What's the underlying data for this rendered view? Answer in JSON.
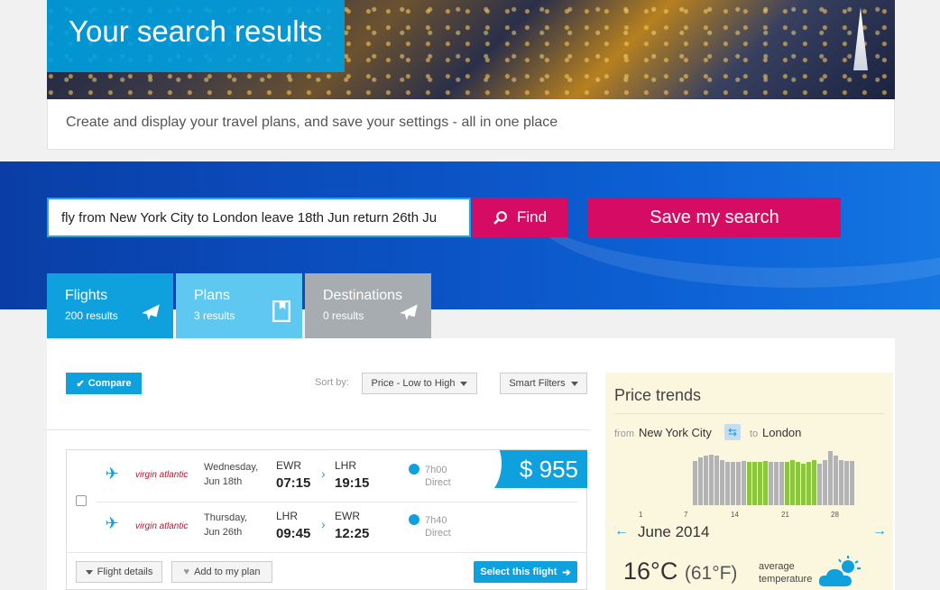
{
  "header": {
    "title": "Your search results",
    "intro": "Create and display your travel plans, and save your settings - all in one place"
  },
  "search": {
    "query": "fly from New York City to London leave 18th Jun return 26th Ju",
    "find_label": "Find",
    "save_label": "Save my search"
  },
  "tabs": [
    {
      "label": "Flights",
      "count": "200 results",
      "icon": "plane-icon"
    },
    {
      "label": "Plans",
      "count": "3 results",
      "icon": "bookmark-icon"
    },
    {
      "label": "Destinations",
      "count": "0 results",
      "icon": "plane-icon"
    }
  ],
  "toolbar": {
    "compare_label": "Compare",
    "sort_label": "Sort by:",
    "sort_value": "Price - Low to High",
    "filters_label": "Smart Filters"
  },
  "result": {
    "price": "$ 955",
    "segments": [
      {
        "airline": "virgin atlantic",
        "day": "Wednesday,",
        "date": "Jun 18th",
        "from_code": "EWR",
        "from_time": "07:15",
        "to_code": "LHR",
        "to_time": "19:15",
        "duration": "7h00",
        "stops": "Direct"
      },
      {
        "airline": "virgin atlantic",
        "day": "Thursday,",
        "date": "Jun 26th",
        "from_code": "LHR",
        "from_time": "09:45",
        "to_code": "EWR",
        "to_time": "12:25",
        "duration": "7h40",
        "stops": "Direct"
      }
    ],
    "details_label": "Flight details",
    "plan_label": "Add to my plan",
    "select_label": "Select this flight"
  },
  "trends": {
    "title": "Price trends",
    "from_label": "from",
    "from_city": "New York City",
    "to_label": "to",
    "to_city": "London",
    "bar_values": [
      0.7,
      0.75,
      0.78,
      0.8,
      0.78,
      0.72,
      0.68,
      0.68,
      0.68,
      0.7,
      0.68,
      0.68,
      0.68,
      0.7,
      0.68,
      0.68,
      0.68,
      0.68,
      0.72,
      0.68,
      0.65,
      0.68,
      0.72,
      0.65,
      0.72,
      0.85,
      0.78,
      0.72,
      0.7,
      0.7
    ],
    "highlight_days": [
      11,
      12,
      13,
      14,
      18,
      19,
      20,
      21,
      22,
      23
    ],
    "ticks": [
      "1",
      "7",
      "14",
      "21",
      "28"
    ],
    "month": "June 2014",
    "temp_c": "16°C",
    "temp_f": "(61°F)",
    "avg_line1": "average",
    "avg_line2": "temperature"
  },
  "colors": {
    "accent": "#0fa0de",
    "brand": "#d60c64",
    "bar": "#b3b3b3",
    "bar_highlight": "#8cc63f"
  }
}
